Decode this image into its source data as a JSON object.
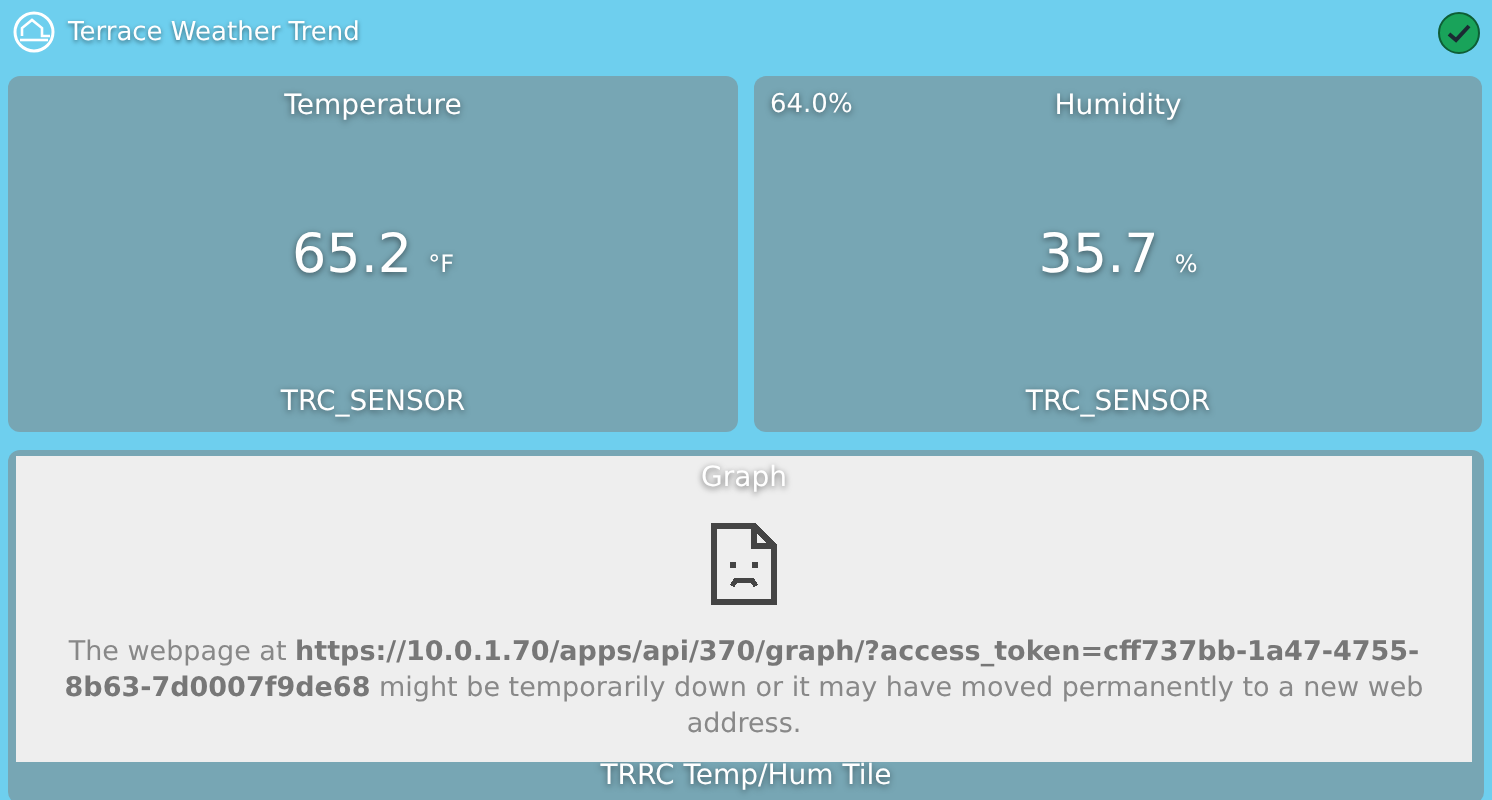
{
  "header": {
    "title": "Terrace Weather Trend",
    "ok": true
  },
  "tiles": [
    {
      "title": "Temperature",
      "value": "65.2",
      "unit": "°F",
      "device": "TRC_SENSOR"
    },
    {
      "corner": "64.0%",
      "title": "Humidity",
      "value": "35.7",
      "unit": "%",
      "device": "TRC_SENSOR"
    }
  ],
  "graph_tile": {
    "title": "Graph",
    "footer": "TRRC Temp/Hum Tile",
    "error": "The webpage at **https://10.0.1.70/apps/api/370/graph/?access_token=cff737bb-1a47-4755-8b63-7d0007f9de68** might be temporarily down or it may have moved permanently to a new web address."
  }
}
